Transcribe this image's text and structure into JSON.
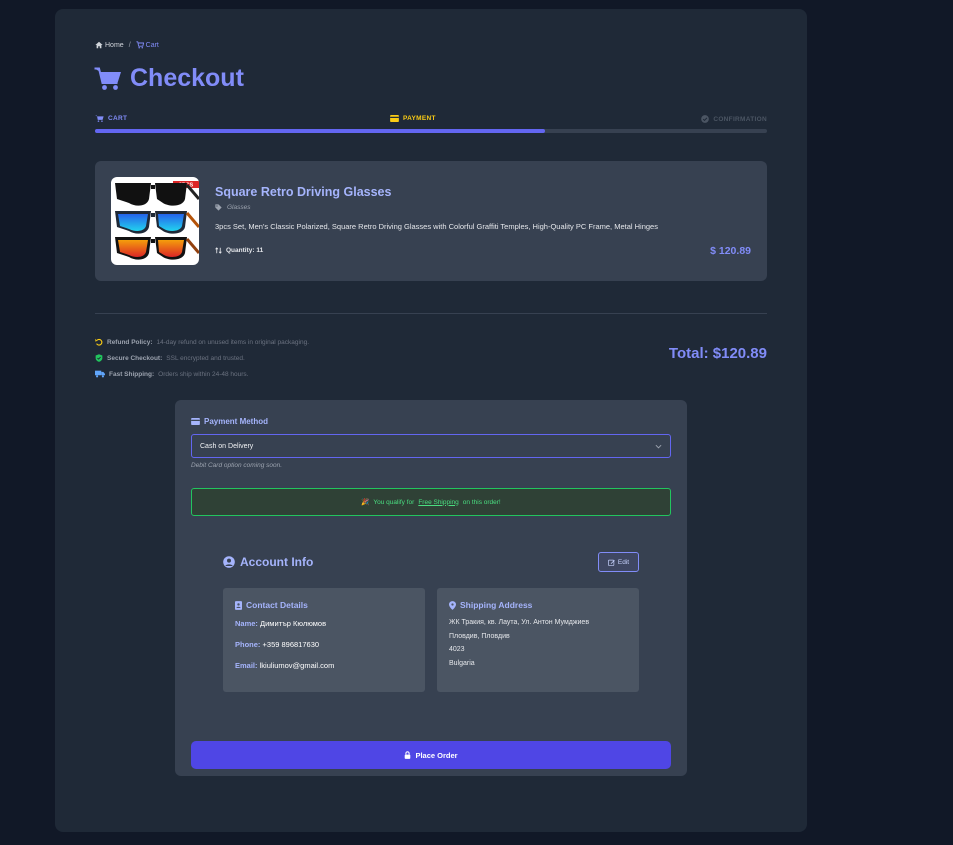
{
  "breadcrumb": {
    "home": "Home",
    "separator": "/",
    "current": "Cart"
  },
  "page_title": "Checkout",
  "steps": [
    {
      "label": "CART",
      "icon": "cart-icon",
      "state": "done"
    },
    {
      "label": "PAYMENT",
      "icon": "credit-card-icon",
      "state": "active"
    },
    {
      "label": "CONFIRMATION",
      "icon": "check-circle-icon",
      "state": "pending"
    }
  ],
  "progress_percent": 67,
  "product": {
    "name": "Square Retro Driving Glasses",
    "category": "Glasses",
    "description": "3pcs Set, Men's Classic Polarized, Square Retro Driving Glasses with Colorful Graffiti Temples, High-Quality PC Frame, Metal Hinges",
    "quantity_label": "Quantity: 11",
    "price": "$ 120.89",
    "image_badge": "3PCS"
  },
  "policies": {
    "refund_label": "Refund Policy:",
    "refund_text": "14-day refund on unused items in original packaging.",
    "secure_label": "Secure Checkout:",
    "secure_text": "SSL encrypted and trusted.",
    "shipping_label": "Fast Shipping:",
    "shipping_text": "Orders ship within 24-48 hours."
  },
  "total": "Total: $120.89",
  "payment": {
    "label": "Payment Method",
    "selected": "Cash on Delivery",
    "note": "Debit Card option coming soon.",
    "shipping_banner_emoji": "🎉",
    "shipping_banner_pre": "You qualify for",
    "shipping_banner_link": "Free Shipping",
    "shipping_banner_post": "on this order!"
  },
  "account": {
    "title": "Account Info",
    "edit_label": "Edit",
    "contact_title": "Contact Details",
    "name_key": "Name:",
    "name_value": "Димитър Кюлюмов",
    "phone_key": "Phone:",
    "phone_value": "+359 896817630",
    "email_key": "Email:",
    "email_value": "lkiuliumov@gmail.com",
    "address_title": "Shipping Address",
    "address_lines": [
      "ЖК Тракия, кв. Лаута, Ул. Антон Мумджиев",
      "Пловдив, Пловдив",
      "4023",
      "Bulgaria"
    ]
  },
  "place_order_label": "Place Order",
  "colors": {
    "accent": "#818cf8",
    "primary_button": "#4f46e5",
    "success": "#22c55e",
    "warning": "#facc15",
    "background": "#111827",
    "panel": "#1f2937",
    "card": "#374151"
  }
}
